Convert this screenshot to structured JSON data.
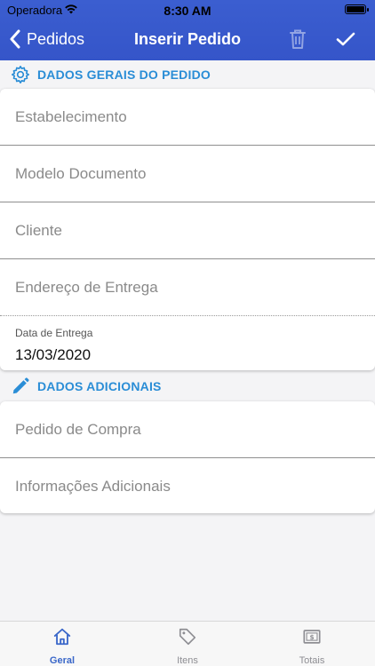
{
  "status": {
    "carrier": "Operadora",
    "time": "8:30 AM"
  },
  "nav": {
    "back_label": "Pedidos",
    "title": "Inserir Pedido"
  },
  "sections": {
    "general": {
      "title": "DADOS GERAIS DO PEDIDO"
    },
    "additional": {
      "title": "DADOS ADICIONAIS"
    }
  },
  "fields": {
    "establishment": {
      "placeholder": "Estabelecimento"
    },
    "document_model": {
      "placeholder": "Modelo Documento"
    },
    "client": {
      "placeholder": "Cliente"
    },
    "delivery_address": {
      "placeholder": "Endereço de Entrega"
    },
    "delivery_date": {
      "label": "Data de Entrega",
      "value": "13/03/2020"
    },
    "purchase_order": {
      "placeholder": "Pedido de Compra"
    },
    "additional_info": {
      "placeholder": "Informações Adicionais"
    }
  },
  "tabs": [
    {
      "label": "Geral",
      "icon": "home-icon",
      "active": true
    },
    {
      "label": "Itens",
      "icon": "tag-icon",
      "active": false
    },
    {
      "label": "Totais",
      "icon": "dollar-bill-icon",
      "active": false
    }
  ],
  "colors": {
    "header": "#3555c9",
    "accent": "#2a8dd6",
    "active_tab": "#3a67c9"
  }
}
